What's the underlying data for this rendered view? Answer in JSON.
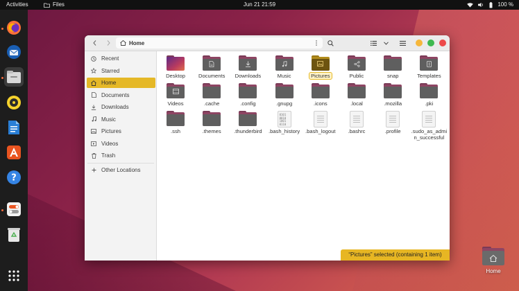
{
  "topbar": {
    "activities": "Activities",
    "app_name": "Files",
    "clock": "Jun 21  21:59",
    "battery": "100 %"
  },
  "dock": {
    "items": [
      "firefox-icon",
      "thunderbird-icon",
      "files-icon",
      "rhythmbox-icon",
      "writer-icon",
      "app-center-icon",
      "help-icon",
      "settings-icon",
      "trash-icon",
      "show-apps-icon"
    ]
  },
  "window": {
    "path": "Home",
    "colors": {
      "accent": "#e5b827",
      "folder_back": "#8e4563",
      "folder_front": "#5f5f5f"
    }
  },
  "sidebar": {
    "items": [
      {
        "label": "Recent",
        "icon": "clock-icon"
      },
      {
        "label": "Starred",
        "icon": "star-icon"
      },
      {
        "label": "Home",
        "icon": "home-icon",
        "active": true
      },
      {
        "label": "Documents",
        "icon": "document-icon"
      },
      {
        "label": "Downloads",
        "icon": "download-icon"
      },
      {
        "label": "Music",
        "icon": "music-icon"
      },
      {
        "label": "Pictures",
        "icon": "picture-icon"
      },
      {
        "label": "Videos",
        "icon": "video-icon"
      },
      {
        "label": "Trash",
        "icon": "trash-icon"
      }
    ],
    "other_locations": "Other Locations"
  },
  "files": [
    {
      "label": "Desktop",
      "kind": "desktop"
    },
    {
      "label": "Documents",
      "kind": "folder",
      "emblem": "document"
    },
    {
      "label": "Downloads",
      "kind": "folder",
      "emblem": "download"
    },
    {
      "label": "Music",
      "kind": "folder",
      "emblem": "music"
    },
    {
      "label": "Pictures",
      "kind": "folder",
      "emblem": "picture",
      "selected": true
    },
    {
      "label": "Public",
      "kind": "folder",
      "emblem": "share"
    },
    {
      "label": "snap",
      "kind": "folder",
      "emblem": ""
    },
    {
      "label": "Templates",
      "kind": "folder",
      "emblem": "template"
    },
    {
      "label": "Videos",
      "kind": "folder",
      "emblem": "video"
    },
    {
      "label": ".cache",
      "kind": "folder",
      "emblem": ""
    },
    {
      "label": ".config",
      "kind": "folder",
      "emblem": ""
    },
    {
      "label": ".gnupg",
      "kind": "folder",
      "emblem": ""
    },
    {
      "label": ".icons",
      "kind": "folder",
      "emblem": ""
    },
    {
      "label": ".local",
      "kind": "folder",
      "emblem": ""
    },
    {
      "label": ".mozilla",
      "kind": "folder",
      "emblem": ""
    },
    {
      "label": ".pki",
      "kind": "folder",
      "emblem": ""
    },
    {
      "label": ".ssh",
      "kind": "folder",
      "emblem": ""
    },
    {
      "label": ".themes",
      "kind": "folder",
      "emblem": ""
    },
    {
      "label": ".thunderbird",
      "kind": "folder",
      "emblem": ""
    },
    {
      "label": ".bash_history",
      "kind": "binary"
    },
    {
      "label": ".bash_logout",
      "kind": "text"
    },
    {
      "label": ".bashrc",
      "kind": "text"
    },
    {
      "label": ".profile",
      "kind": "text"
    },
    {
      "label": ".sudo_as_admin_successful",
      "kind": "text"
    }
  ],
  "binary_glyph": "0101\n0010\n1001\n0110",
  "status": "“Pictures” selected  (containing 1 item)",
  "desktop_home": {
    "label": "Home"
  }
}
